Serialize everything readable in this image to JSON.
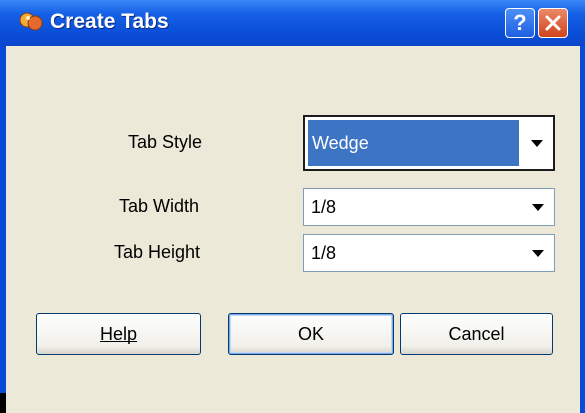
{
  "window": {
    "title": "Create Tabs",
    "help_button": "?",
    "close_button": "close"
  },
  "form": {
    "tab_style": {
      "label": "Tab Style",
      "value": "Wedge"
    },
    "tab_width": {
      "label": "Tab Width",
      "value": "1/8"
    },
    "tab_height": {
      "label": "Tab Height",
      "value": "1/8"
    }
  },
  "buttons": {
    "help": "Help",
    "ok": "OK",
    "cancel": "Cancel"
  },
  "colors": {
    "titlebar": "#0b4fd8",
    "dialog_bg": "#ece9d8",
    "selection": "#3d74c4",
    "close_red": "#d0431b"
  }
}
